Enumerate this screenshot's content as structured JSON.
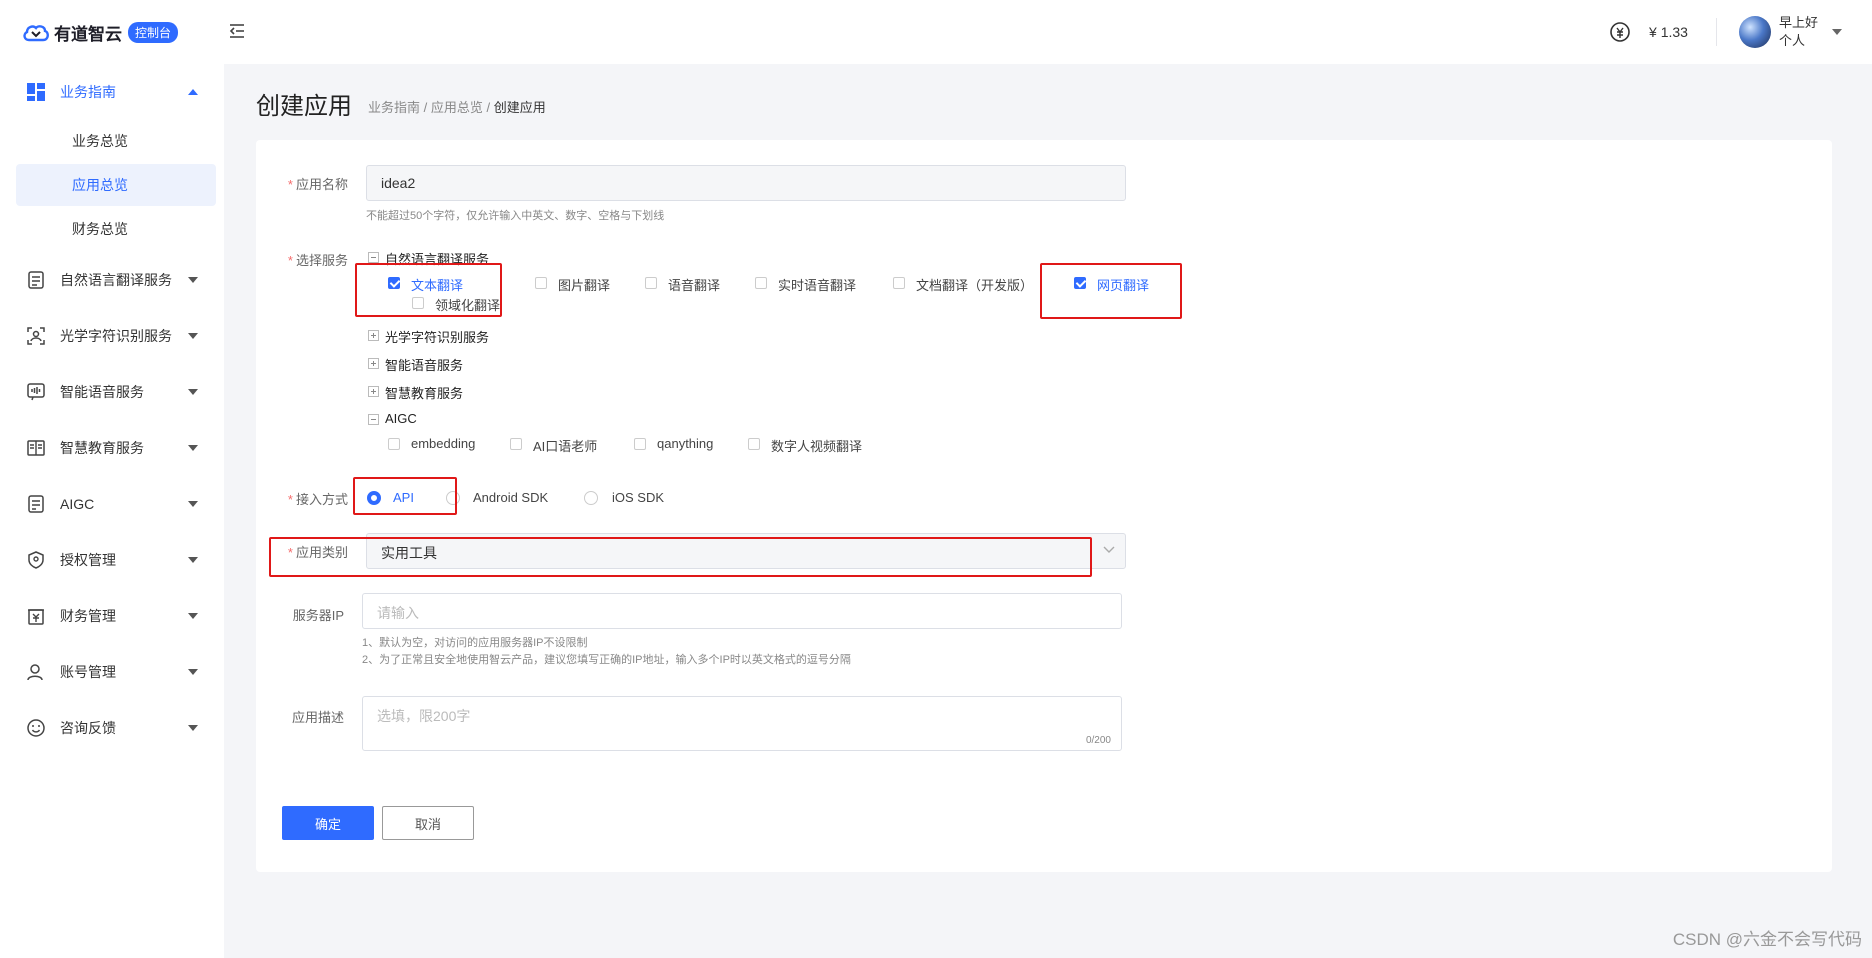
{
  "header": {
    "logo_text": "有道智云",
    "logo_badge": "控制台",
    "balance": "¥ 1.33",
    "greeting": "早上好",
    "account_type": "个人"
  },
  "sidebar": {
    "items": [
      {
        "label": "业务指南",
        "icon": "dashboard-icon",
        "expanded": true,
        "children": [
          {
            "label": "业务总览"
          },
          {
            "label": "应用总览",
            "selected": true
          },
          {
            "label": "财务总览"
          }
        ]
      },
      {
        "label": "自然语言翻译服务",
        "icon": "translate-doc-icon"
      },
      {
        "label": "光学字符识别服务",
        "icon": "ocr-scan-icon"
      },
      {
        "label": "智能语音服务",
        "icon": "voice-icon"
      },
      {
        "label": "智慧教育服务",
        "icon": "education-icon"
      },
      {
        "label": "AIGC",
        "icon": "aigc-icon"
      },
      {
        "label": "授权管理",
        "icon": "auth-icon"
      },
      {
        "label": "财务管理",
        "icon": "finance-icon"
      },
      {
        "label": "账号管理",
        "icon": "account-icon"
      },
      {
        "label": "咨询反馈",
        "icon": "feedback-icon"
      }
    ]
  },
  "page": {
    "title": "创建应用",
    "breadcrumb": [
      "业务指南",
      "应用总览",
      "创建应用"
    ],
    "sep": " / "
  },
  "form": {
    "app_name": {
      "label": "应用名称",
      "value": "idea2",
      "hint": "不能超过50个字符，仅允许输入中英文、数字、空格与下划线"
    },
    "services": {
      "label": "选择服务",
      "groups": [
        {
          "name": "自然语言翻译服务",
          "expanded": true,
          "options": [
            {
              "label": "文本翻译",
              "checked": true
            },
            {
              "label": "领域化翻译",
              "checked": false
            },
            {
              "label": "图片翻译",
              "checked": false
            },
            {
              "label": "语音翻译",
              "checked": false
            },
            {
              "label": "实时语音翻译",
              "checked": false
            },
            {
              "label": "文档翻译（开发版）",
              "checked": false
            },
            {
              "label": "网页翻译",
              "checked": true
            }
          ]
        },
        {
          "name": "光学字符识别服务",
          "expanded": false
        },
        {
          "name": "智能语音服务",
          "expanded": false
        },
        {
          "name": "智慧教育服务",
          "expanded": false
        },
        {
          "name": "AIGC",
          "expanded": true,
          "options": [
            {
              "label": "embedding",
              "checked": false
            },
            {
              "label": "AI口语老师",
              "checked": false
            },
            {
              "label": "qanything",
              "checked": false
            },
            {
              "label": "数字人视频翻译",
              "checked": false
            }
          ]
        }
      ]
    },
    "access": {
      "label": "接入方式",
      "options": [
        "API",
        "Android SDK",
        "iOS SDK"
      ],
      "selected": "API"
    },
    "category": {
      "label": "应用类别",
      "value": "实用工具"
    },
    "server_ip": {
      "label": "服务器IP",
      "placeholder": "请输入",
      "hints": [
        "1、默认为空，对访问的应用服务器IP不设限制",
        "2、为了正常且安全地使用智云产品，建议您填写正确的IP地址，输入多个IP时以英文格式的逗号分隔"
      ]
    },
    "description": {
      "label": "应用描述",
      "placeholder": "选填，限200字",
      "counter": "0/200"
    },
    "confirm": "确定",
    "cancel": "取消"
  },
  "watermark": "CSDN @六金不会写代码",
  "colors": {
    "primary": "#2f6bff",
    "annotation": "#e01818",
    "required": "#f56c6c"
  }
}
